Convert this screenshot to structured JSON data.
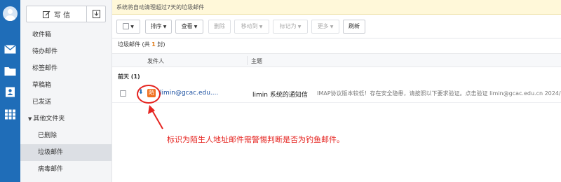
{
  "rail": {
    "icons": [
      "avatar-icon",
      "mail-icon",
      "folder-icon",
      "contacts-icon",
      "apps-grid-icon"
    ]
  },
  "sidebar": {
    "compose_label": "写 信",
    "folders": [
      {
        "label": "收件箱"
      },
      {
        "label": "待办邮件"
      },
      {
        "label": "标签邮件"
      },
      {
        "label": "草稿箱"
      },
      {
        "label": "已发送"
      },
      {
        "label": "其他文件夹"
      },
      {
        "label": "已删除"
      },
      {
        "label": "垃圾邮件"
      },
      {
        "label": "病毒邮件"
      }
    ],
    "active_folder": "垃圾邮件"
  },
  "notice": {
    "text": "系统将自动清理超过7天的垃圾邮件"
  },
  "toolbar": {
    "sort_label": "排序",
    "view_label": "查看",
    "delete_label": "删除",
    "move_label": "移动到",
    "mark_label": "标记为",
    "more_label": "更多",
    "refresh_label": "刷新"
  },
  "list": {
    "title_prefix": "垃圾邮件 (共 ",
    "count": "1",
    "title_suffix": " 封)",
    "columns": {
      "sender": "发件人",
      "subject": "主题"
    },
    "group_label": "前天 (1)",
    "rows": [
      {
        "stranger_badge": "陌",
        "sender": "limin@gcac.edu....",
        "subject": "limin 系统的通知信",
        "snippet": "IMAP协议版本较低！存在安全隐患，请按照以下要求验证。点击验证 limin@gcac.edu.cn 2024/3"
      }
    ]
  },
  "annotation": {
    "text": "标识为陌生人地址邮件需警惕判断是否为钓鱼邮件。",
    "color": "#e52420"
  },
  "colors": {
    "rail": "#1f6db8",
    "accent": "#e07a15",
    "badge": "#f07020"
  }
}
